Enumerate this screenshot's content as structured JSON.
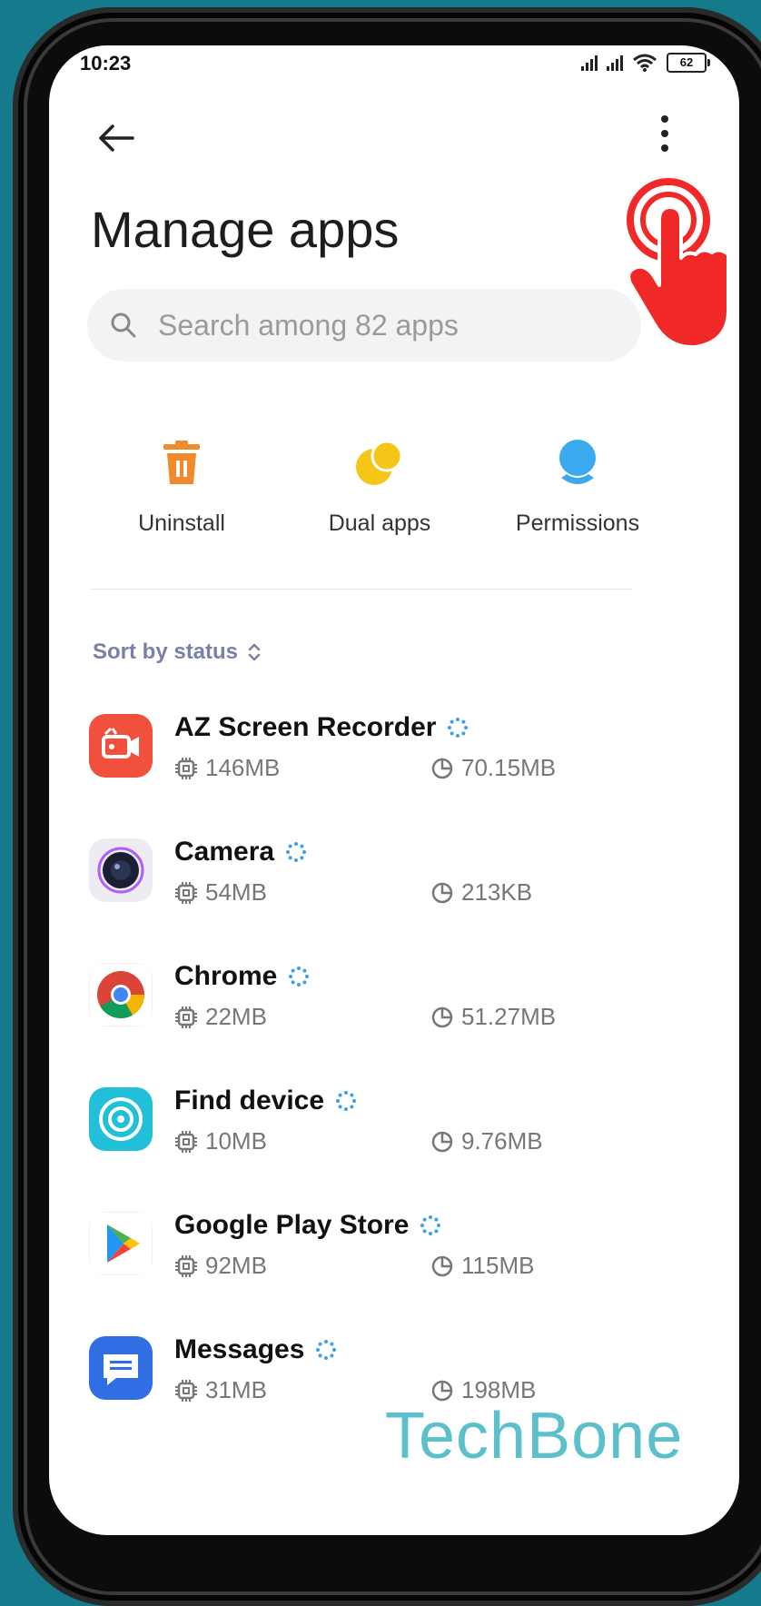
{
  "status_bar": {
    "time": "10:23",
    "battery": "62"
  },
  "header": {
    "title": "Manage apps"
  },
  "search": {
    "placeholder": "Search among 82 apps"
  },
  "actions": [
    {
      "label": "Uninstall",
      "icon": "trash-icon",
      "color": "#f08a2a"
    },
    {
      "label": "Dual apps",
      "icon": "dual-circles-icon",
      "color": "#f5c518"
    },
    {
      "label": "Permissions",
      "icon": "permissions-icon",
      "color": "#3aa9f0"
    }
  ],
  "sort": {
    "label": "Sort by status"
  },
  "apps": [
    {
      "name": "AZ Screen Recorder",
      "size": "146MB",
      "cache": "70.15MB",
      "icon": "az-recorder-icon",
      "color": "#f0503c"
    },
    {
      "name": "Camera",
      "size": "54MB",
      "cache": "213KB",
      "icon": "camera-icon",
      "color": "#e8e8ee"
    },
    {
      "name": "Chrome",
      "size": "22MB",
      "cache": "51.27MB",
      "icon": "chrome-icon",
      "color": "#ffffff"
    },
    {
      "name": "Find device",
      "size": "10MB",
      "cache": "9.76MB",
      "icon": "find-device-icon",
      "color": "#22bfd8"
    },
    {
      "name": "Google Play Store",
      "size": "92MB",
      "cache": "115MB",
      "icon": "play-store-icon",
      "color": "#ffffff"
    },
    {
      "name": "Messages",
      "size": "31MB",
      "cache": "198MB",
      "icon": "messages-icon",
      "color": "#2f6fe3"
    }
  ],
  "watermark": {
    "text": "TechBone"
  }
}
